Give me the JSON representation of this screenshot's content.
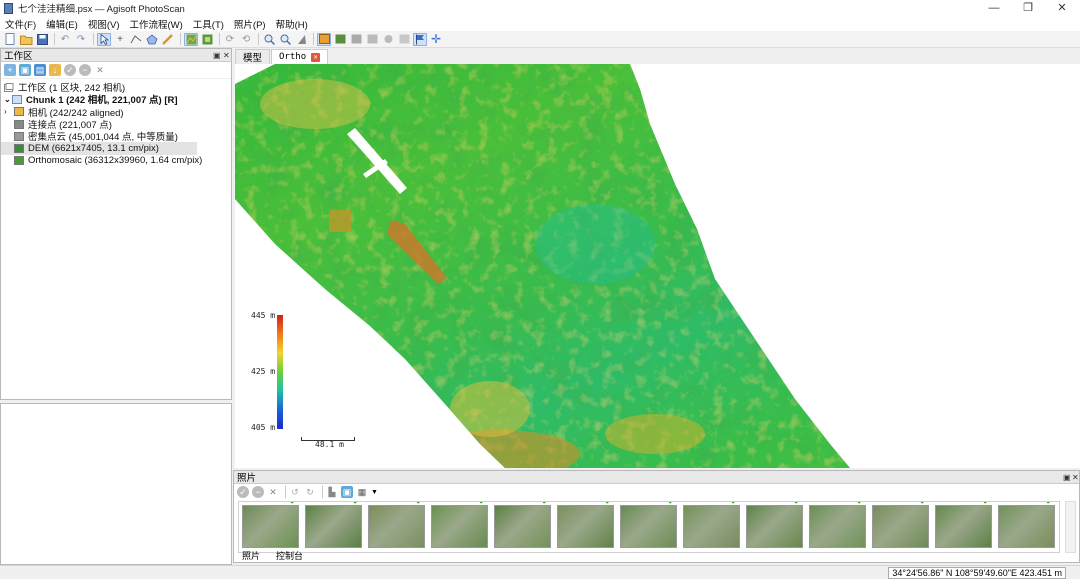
{
  "window": {
    "title": "七个洼洼精细.psx — Agisoft PhotoScan",
    "minimize_glyph": "—",
    "restore_glyph": "❐",
    "close_glyph": "✕"
  },
  "menu": [
    "文件(F)",
    "编辑(E)",
    "视图(V)",
    "工作流程(W)",
    "工具(T)",
    "照片(P)",
    "帮助(H)"
  ],
  "workspace": {
    "header": "工作区",
    "root": "工作区 (1 区块, 242 相机)",
    "chunk": "Chunk 1 (242 相机, 221,007 点) [R]",
    "items": [
      {
        "label": "相机 (242/242 aligned)",
        "icon": "folder-icon",
        "color": "#e8b84a"
      },
      {
        "label": "连接点 (221,007 点)",
        "icon": "tie-points-icon",
        "color": "#888888"
      },
      {
        "label": "密集点云 (45,001,044 点, 中等质量)",
        "icon": "dense-cloud-icon",
        "color": "#999999"
      },
      {
        "label": "DEM (6621x7405, 13.1 cm/pix)",
        "icon": "dem-icon",
        "color": "#3a8a3a"
      },
      {
        "label": "Orthomosaic (36312x39960, 1.64 cm/pix)",
        "icon": "ortho-icon",
        "color": "#4a9a3a"
      }
    ],
    "selected_index": 3
  },
  "tabs": {
    "model": "模型",
    "ortho": "Ortho"
  },
  "viewport": {
    "colorbar_labels": [
      "445 m",
      "425 m",
      "405 m"
    ],
    "scale_label": "48.1 m"
  },
  "photos": {
    "header": "照片",
    "thumb_count": 13,
    "check_glyph": "✔"
  },
  "bottom_tabs": [
    "照片",
    "控制台"
  ],
  "status": {
    "coords": "34°24'56.86\" N  108°59'49.60\"E 423.451 m"
  },
  "colors": {
    "dem_low": "#1cc0a8",
    "dem_mid": "#3ec43a",
    "dem_high": "#d8a22a",
    "accent": "#8bb2e0"
  }
}
